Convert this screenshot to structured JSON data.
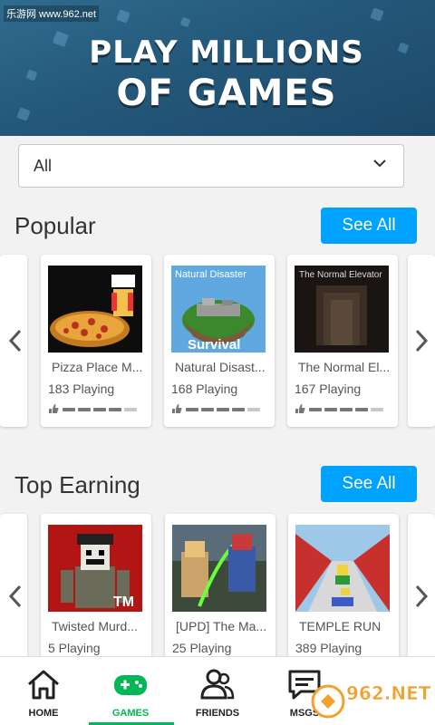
{
  "banner": {
    "line1": "PLAY MILLIONS",
    "line2": "OF GAMES",
    "watermark": "乐游网 www.962.net"
  },
  "filter": {
    "selected": "All"
  },
  "sections": [
    {
      "title": "Popular",
      "see_all": "See All",
      "games": [
        {
          "name": "Pizza Place M...",
          "playing": "183 Playing",
          "rating": 0.8
        },
        {
          "name": "Natural Disast...",
          "playing": "168 Playing",
          "rating": 0.85
        },
        {
          "name": "The Normal El...",
          "playing": "167 Playing",
          "rating": 0.8
        }
      ]
    },
    {
      "title": "Top Earning",
      "see_all": "See All",
      "games": [
        {
          "name": "Twisted Murd...",
          "playing": "5 Playing"
        },
        {
          "name": "[UPD] The Ma...",
          "playing": "25 Playing"
        },
        {
          "name": "TEMPLE RUN",
          "playing": "389 Playing"
        }
      ]
    }
  ],
  "thumb_text": {
    "natural_top": "Natural Disaster",
    "natural_bottom": "Survival",
    "elevator": "The Normal Elevator",
    "tm": "TM"
  },
  "nav": [
    {
      "label": "HOME",
      "icon": "home-icon"
    },
    {
      "label": "GAMES",
      "icon": "gamepad-icon",
      "active": true
    },
    {
      "label": "FRIENDS",
      "icon": "friends-icon"
    },
    {
      "label": "MSGS",
      "icon": "messages-icon"
    }
  ],
  "colors": {
    "accent": "#00a2ff",
    "active_nav": "#02b757",
    "banner": "#24587a"
  },
  "bottom_watermark": "962.NET 乐游网"
}
